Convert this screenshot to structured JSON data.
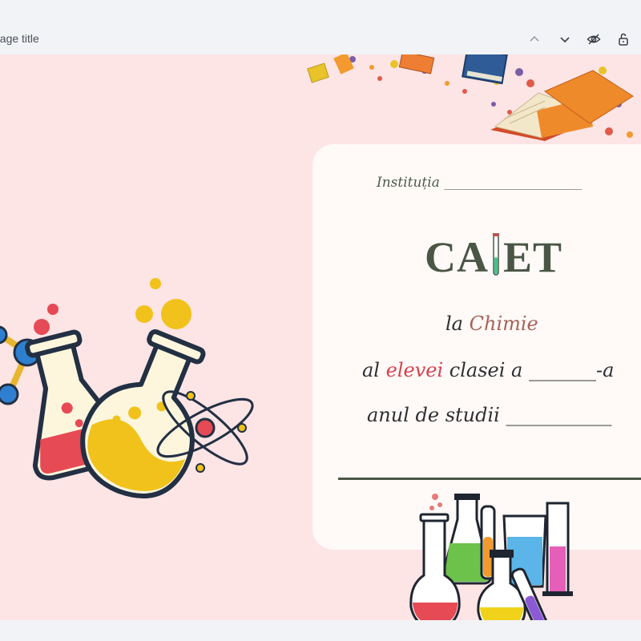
{
  "toolbar": {
    "page_title_placeholder": "page title",
    "icons": [
      "chevron-up-icon",
      "chevron-down-icon",
      "eye-icon",
      "lock-icon"
    ]
  },
  "cover": {
    "institution_label": "Instituția",
    "institution_blank": "_______________________",
    "title_left": "CA",
    "title_right": "ET",
    "line1_prefix": "la ",
    "line1_subject": "Chimie",
    "line2_prefix": "al ",
    "line2_accent": "elevei",
    "line2_suffix": " clasei a _______-a",
    "line3": "anul de studii ___________"
  },
  "colors": {
    "background": "#fde4e5",
    "card": "#fffaf7",
    "title": "#4a5646",
    "subject_accent": "#a8625a",
    "student_accent": "#d6414e"
  }
}
